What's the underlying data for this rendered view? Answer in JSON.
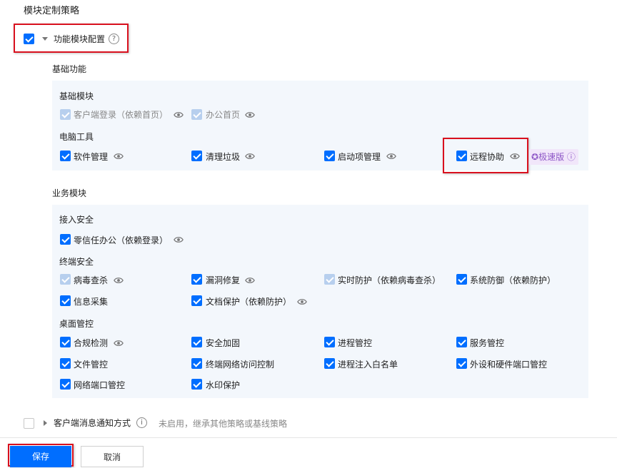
{
  "page_title": "模块定制策略",
  "feature_config": {
    "label": "功能模块配置",
    "checked": true
  },
  "basic_section": {
    "title": "基础功能",
    "groups": [
      {
        "title": "基础模块",
        "items": [
          {
            "label": "客户端登录（依赖首页）",
            "state": "disabled-checked",
            "eye": true
          },
          {
            "label": "办公首页",
            "state": "disabled-checked",
            "eye": true
          }
        ]
      },
      {
        "title": "电脑工具",
        "items": [
          {
            "label": "软件管理",
            "state": "checked",
            "eye": true
          },
          {
            "label": "清理垃圾",
            "state": "checked",
            "eye": true
          },
          {
            "label": "启动项管理",
            "state": "checked",
            "eye": true
          },
          {
            "label": "远程协助",
            "state": "checked",
            "eye": true,
            "badge": "极速版"
          }
        ]
      }
    ]
  },
  "business_section": {
    "title": "业务模块",
    "groups": [
      {
        "title": "接入安全",
        "items": [
          {
            "label": "零信任办公（依赖登录）",
            "state": "checked",
            "eye": true
          }
        ]
      },
      {
        "title": "终端安全",
        "items": [
          {
            "label": "病毒查杀",
            "state": "disabled-checked",
            "eye": true
          },
          {
            "label": "漏洞修复",
            "state": "checked",
            "eye": true
          },
          {
            "label": "实时防护（依赖病毒查杀）",
            "state": "disabled-checked",
            "eye": false
          },
          {
            "label": "系统防御（依赖防护）",
            "state": "checked",
            "eye": false
          },
          {
            "label": "信息采集",
            "state": "checked",
            "eye": false
          },
          {
            "label": "文档保护（依赖防护）",
            "state": "checked",
            "eye": true
          }
        ]
      },
      {
        "title": "桌面管控",
        "items": [
          {
            "label": "合规检测",
            "state": "checked",
            "eye": true
          },
          {
            "label": "安全加固",
            "state": "checked",
            "eye": false
          },
          {
            "label": "进程管控",
            "state": "checked",
            "eye": false
          },
          {
            "label": "服务管控",
            "state": "checked",
            "eye": false
          },
          {
            "label": "文件管控",
            "state": "checked",
            "eye": false
          },
          {
            "label": "终端网络访问控制",
            "state": "checked",
            "eye": false
          },
          {
            "label": "进程注入白名单",
            "state": "checked",
            "eye": false
          },
          {
            "label": "外设和硬件端口管控",
            "state": "checked",
            "eye": false
          },
          {
            "label": "网络端口管控",
            "state": "checked",
            "eye": false
          },
          {
            "label": "水印保护",
            "state": "checked",
            "eye": false
          }
        ]
      }
    ]
  },
  "notify": {
    "label": "客户端消息通知方式",
    "hint": "未启用，继承其他策略或基线策略",
    "checked": false
  },
  "footer": {
    "save_label": "保存",
    "cancel_label": "取消"
  },
  "colors": {
    "primary": "#006eff",
    "highlight": "#d9101e",
    "panel_bg": "#f3f7fc",
    "badge": "#8e57c7"
  }
}
